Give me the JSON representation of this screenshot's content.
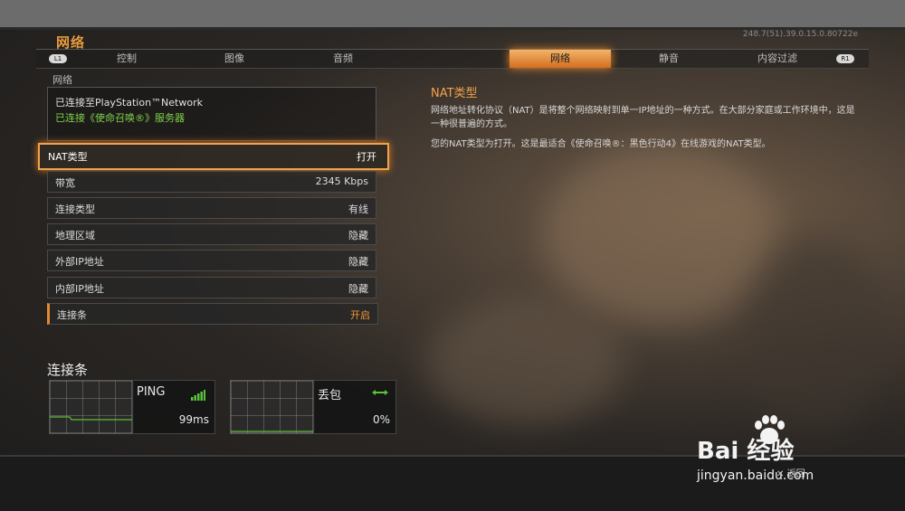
{
  "header": {
    "title": "网络",
    "version": "248.7(51).39.0.15.0.80722e"
  },
  "tabs": {
    "left_hint": "L1",
    "right_hint": "R1",
    "items": [
      {
        "label": "控制"
      },
      {
        "label": "图像"
      },
      {
        "label": "音频"
      },
      {
        "label": ""
      },
      {
        "label": "网络"
      },
      {
        "label": "静音"
      },
      {
        "label": "内容过滤"
      }
    ]
  },
  "section": {
    "label": "网络"
  },
  "status": {
    "line1": "已连接至PlayStation™Network",
    "line2": "已连接《使命召唤®》服务器"
  },
  "rows": [
    {
      "label": "NAT类型",
      "value": "打开"
    },
    {
      "label": "带宽",
      "value": "2345 Kbps"
    },
    {
      "label": "连接类型",
      "value": "有线"
    },
    {
      "label": "地理区域",
      "value": "隐藏"
    },
    {
      "label": "外部IP地址",
      "value": "隐藏"
    },
    {
      "label": "内部IP地址",
      "value": "隐藏"
    },
    {
      "label": "连接条",
      "value": "开启"
    }
  ],
  "description": {
    "title": "NAT类型",
    "p1": "网络地址转化协议（NAT）是将整个网络映射到单一IP地址的一种方式。在大部分家庭或工作环境中，这是一种很普遍的方式。",
    "p2": "您的NAT类型为打开。这是最适合《使命召唤®：黑色行动4》在线游戏的NAT类型。"
  },
  "connection": {
    "title": "连接条",
    "ping_label": "PING",
    "ping_value": "99ms",
    "loss_label": "丢包",
    "loss_value": "0%"
  },
  "footer": {
    "back_label": "返回"
  },
  "watermark": {
    "brand": "Bai 经验",
    "url": "jingyan.baidu.com"
  },
  "colors": {
    "accent": "#e89a3c",
    "connected": "#7ed24a",
    "signal": "#57c43a"
  }
}
